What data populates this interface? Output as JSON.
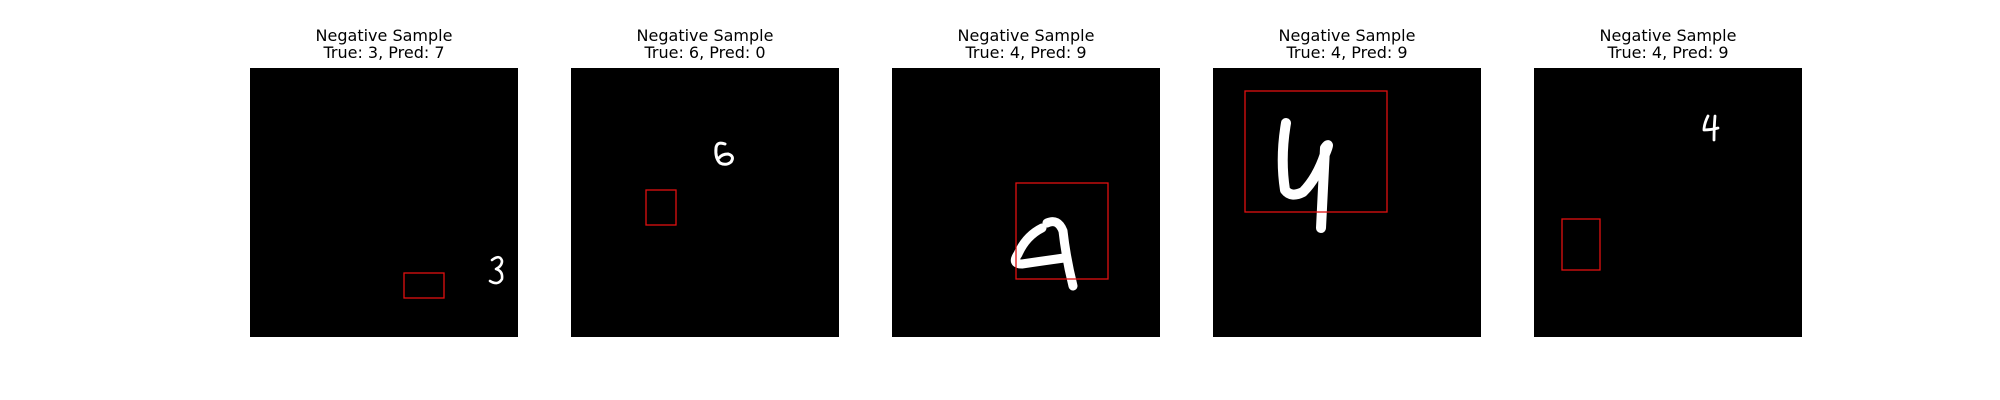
{
  "panels": [
    {
      "heading": "Negative Sample",
      "caption": "True: 3, Pred: 7",
      "true_label": 3,
      "predicted_label": 7,
      "digit": "3"
    },
    {
      "heading": "Negative Sample",
      "caption": "True: 6, Pred: 0",
      "true_label": 6,
      "predicted_label": 0,
      "digit": "6"
    },
    {
      "heading": "Negative Sample",
      "caption": "True: 4, Pred: 9",
      "true_label": 4,
      "predicted_label": 9,
      "digit": "4"
    },
    {
      "heading": "Negative Sample",
      "caption": "True: 4, Pred: 9",
      "true_label": 4,
      "predicted_label": 9,
      "digit": "4"
    },
    {
      "heading": "Negative Sample",
      "caption": "True: 4, Pred: 9",
      "true_label": 4,
      "predicted_label": 9,
      "digit": "4"
    }
  ],
  "colors": {
    "background": "#ffffff",
    "image_background": "#000000",
    "digit": "#ffffff",
    "bounding_box": "#e01010"
  }
}
